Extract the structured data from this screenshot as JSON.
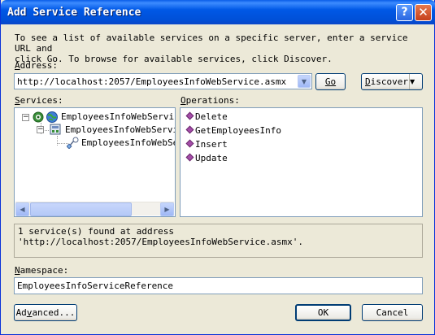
{
  "window": {
    "title": "Add Service Reference",
    "help_glyph": "?",
    "close_glyph": "✕"
  },
  "description": {
    "line1": "To see a list of available services on a specific server, enter a service URL and",
    "line2": "click Go. To browse for available services, click Discover."
  },
  "address": {
    "label_accel": "A",
    "label_rest": "ddress:",
    "value": "http://localhost:2057/EmployeesInfoWebService.asmx",
    "go_label": "Go",
    "discover_accel": "D",
    "discover_rest": "iscover"
  },
  "services": {
    "label_accel": "S",
    "label_rest": "ervices:",
    "nodes": [
      {
        "label": "EmployeesInfoWebService"
      },
      {
        "label": "EmployeesInfoWebService"
      },
      {
        "label": "EmployeesInfoWebServ"
      }
    ]
  },
  "operations": {
    "label_accel": "O",
    "label_rest": "perations:",
    "items": [
      "Delete",
      "GetEmployeesInfo",
      "Insert",
      "Update"
    ]
  },
  "status": {
    "line1": "1 service(s) found at address",
    "line2": "'http://localhost:2057/EmployeesInfoWebService.asmx'."
  },
  "namespace": {
    "label_accel": "N",
    "label_rest": "amespace:",
    "value": "EmployeesInfoServiceReference"
  },
  "footer": {
    "advanced_pre": "Ad",
    "advanced_accel": "v",
    "advanced_rest": "anced...",
    "ok_label": "OK",
    "cancel_label": "Cancel"
  },
  "icons": [
    "help-icon",
    "close-icon",
    "dropdown-arrow-icon",
    "globe-icon",
    "service-icon",
    "endpoint-icon",
    "operation-icon",
    "scroll-left-icon",
    "scroll-right-icon"
  ]
}
